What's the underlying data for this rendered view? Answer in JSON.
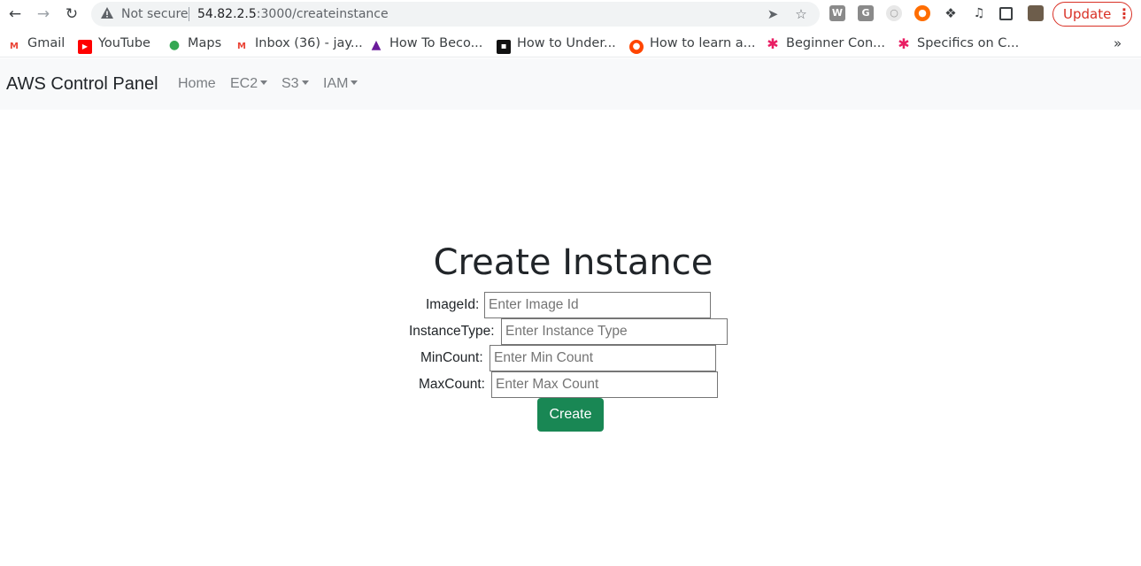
{
  "browser": {
    "security_label": "Not secure",
    "url_host": "54.82.2.5",
    "url_path": ":3000/createinstance",
    "update_label": "Update",
    "bookmarks": [
      {
        "label": "Gmail",
        "icon": "gmail-icon",
        "icon_color": "#ea4335"
      },
      {
        "label": "YouTube",
        "icon": "youtube-icon",
        "icon_color": "#ff0000"
      },
      {
        "label": "Maps",
        "icon": "maps-icon",
        "icon_color": "#34a853"
      },
      {
        "label": "Inbox (36) - jay...",
        "icon": "gmail-icon",
        "icon_color": "#ea4335"
      },
      {
        "label": "How To Beco...",
        "icon": "triangle-logo-icon",
        "icon_color": "#6a1b9a"
      },
      {
        "label": "How to Under...",
        "icon": "dark-logo-icon",
        "icon_color": "#111111"
      },
      {
        "label": "How to learn a...",
        "icon": "reddit-icon",
        "icon_color": "#ff4500"
      },
      {
        "label": "Beginner Con...",
        "icon": "asterisk-icon",
        "icon_color": "#e91e63"
      },
      {
        "label": "Specifics on C...",
        "icon": "asterisk-icon",
        "icon_color": "#e91e63"
      }
    ]
  },
  "navbar": {
    "brand": "AWS Control Panel",
    "links": [
      {
        "label": "Home",
        "dropdown": false
      },
      {
        "label": "EC2",
        "dropdown": true
      },
      {
        "label": "S3",
        "dropdown": true
      },
      {
        "label": "IAM",
        "dropdown": true
      }
    ]
  },
  "form": {
    "title": "Create Instance",
    "fields": [
      {
        "label": "ImageId:",
        "placeholder": "Enter Image Id",
        "value": ""
      },
      {
        "label": "InstanceType:",
        "placeholder": "Enter Instance Type",
        "value": ""
      },
      {
        "label": "MinCount:",
        "placeholder": "Enter Min Count",
        "value": ""
      },
      {
        "label": "MaxCount:",
        "placeholder": "Enter Max Count",
        "value": ""
      }
    ],
    "submit_label": "Create"
  },
  "colors": {
    "primary_button": "#198754",
    "navbar_bg": "#f8f9fa",
    "update_accent": "#d93025"
  }
}
